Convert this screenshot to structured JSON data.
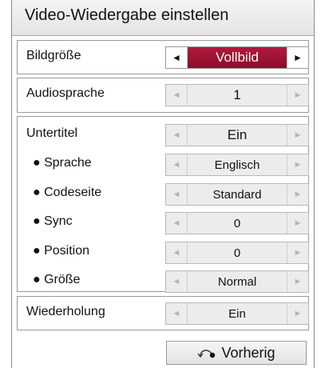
{
  "title": "Video-Wiedergabe einstellen",
  "rows": [
    {
      "label": "Bildgröße",
      "value": "Vollbild",
      "active": true
    },
    {
      "label": "Audiosprache",
      "value": "1"
    },
    {
      "label": "Untertitel",
      "value": "Ein"
    },
    {
      "label": "● Sprache",
      "value": "Englisch"
    },
    {
      "label": "● Codeseite",
      "value": "Standard"
    },
    {
      "label": "● Sync",
      "value": "0"
    },
    {
      "label": "● Position",
      "value": "0"
    },
    {
      "label": "● Größe",
      "value": "Normal"
    },
    {
      "label": "Wiederholung",
      "value": "Ein"
    }
  ],
  "arrows": {
    "left": "◄",
    "right": "►"
  },
  "back_button": {
    "label": "Vorherig",
    "icon": "back-return-icon"
  },
  "colors": {
    "accent": "#9e1234",
    "panel_border": "#8a8a8a",
    "disabled_bg": "#ececec"
  }
}
